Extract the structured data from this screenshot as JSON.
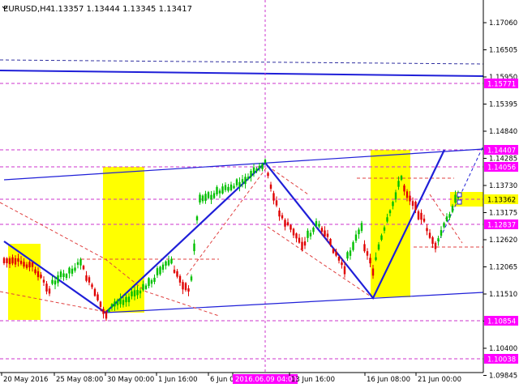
{
  "header": {
    "symbol_timeframe": "EURUSD,H4",
    "ohlc": "1.13357 1.13444 1.13345 1.13417"
  },
  "colors": {
    "candle_up": "#00c000",
    "candle_down": "#e00000",
    "trend_line": "#1f1fd8",
    "level_line": "#cc33cc",
    "channel_line": "#b030b0",
    "projection_line": "#e04040",
    "highlight_zone": "#ffff00",
    "label_bg": "#ff00ff"
  },
  "price_axis": {
    "labels": [
      "1.17060",
      "1.16505",
      "1.15950",
      "1.15395",
      "1.14840",
      "1.14285",
      "1.13730",
      "1.13175",
      "1.12620",
      "1.12065",
      "1.11510",
      "1.10955",
      "1.10400",
      "1.09845"
    ],
    "level_tags": [
      {
        "value": "1.15771",
        "kind": "level"
      },
      {
        "value": "1.14407",
        "kind": "level"
      },
      {
        "value": "1.14056",
        "kind": "level"
      },
      {
        "value": "1.13362",
        "kind": "current"
      },
      {
        "value": "1.12837",
        "kind": "level"
      },
      {
        "value": "1.10854",
        "kind": "level"
      },
      {
        "value": "1.10038",
        "kind": "level"
      }
    ]
  },
  "time_axis": {
    "labels": [
      "20 May 2016",
      "25 May 08:00",
      "30 May 00:00",
      "1 Jun 16:00",
      "6 Jun 00:00",
      "2016.06.09 04:00",
      "13 Jun 16:00",
      "16 Jun 08:00",
      "21 Jun 00:00"
    ],
    "crosshair_label": "2016.06.09 04:00"
  },
  "chart_data": {
    "type": "candlestick",
    "title": "EURUSD,H4",
    "ylim": [
      1.0955,
      1.1765
    ],
    "trend_path": [
      [
        "2016-05-23 00:00",
        1.124
      ],
      [
        "2016-05-30 00:00",
        1.109
      ],
      [
        "2016-06-09 04:00",
        1.1415
      ],
      [
        "2016-06-15 20:00",
        1.112
      ],
      [
        "2016-06-22 08:00",
        1.144
      ]
    ],
    "resistance_line": [
      [
        "2016-05-19 00:00",
        1.1385
      ],
      [
        "2016-06-23 12:00",
        1.1444
      ]
    ],
    "support_line": [
      [
        "2016-05-30 00:00",
        1.109
      ],
      [
        "2016-06-23 12:00",
        1.113
      ]
    ]
  }
}
